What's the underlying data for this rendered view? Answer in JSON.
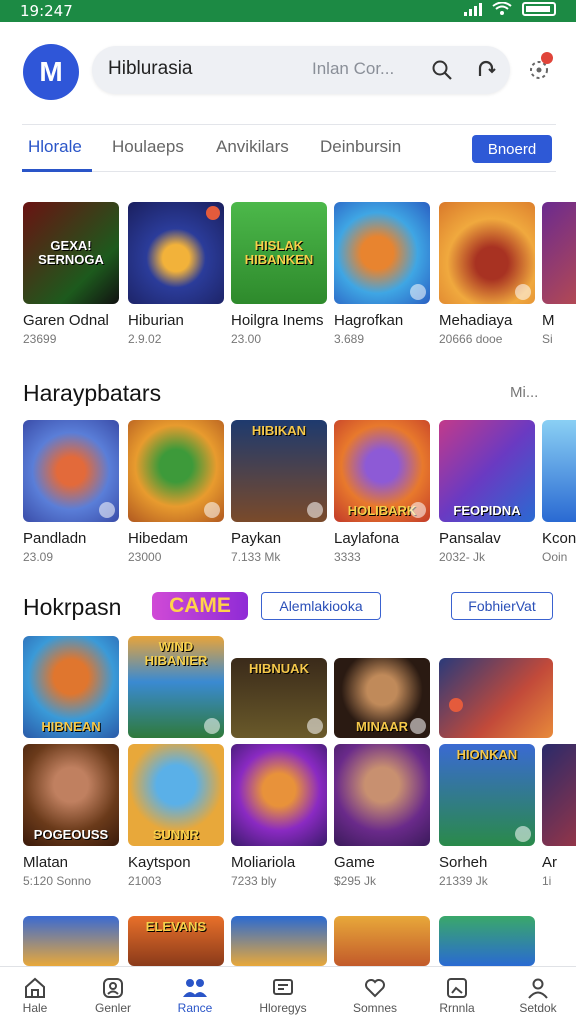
{
  "status": {
    "time": "19:247"
  },
  "colors": {
    "accent": "#2e59d6",
    "status_bar": "#1c8a44"
  },
  "header": {
    "logo_letter": "M",
    "search_title": "Hiblurasia",
    "search_placeholder": "Inlan Cor...",
    "icons": [
      "search-icon",
      "refresh-icon",
      "notification-icon"
    ]
  },
  "tabs": {
    "items": [
      "Hlorale",
      "Houlaeps",
      "Anvikilars",
      "Deinbursin"
    ],
    "active": 0,
    "button_label": "Bnoerd"
  },
  "row1": [
    {
      "thumb_text": "GEXA! SERNOGA",
      "name": "Garen Odnal",
      "meta": "23699"
    },
    {
      "thumb_text": "",
      "name": "Hiburian",
      "meta": "2.9.02"
    },
    {
      "thumb_text": "HISLAK HIBANKEN",
      "name": "Hoilgra Inems",
      "meta": "23.00"
    },
    {
      "thumb_text": "",
      "name": "Hagrofkan",
      "meta": "3.689"
    },
    {
      "thumb_text": "",
      "name": "Mehadiaya",
      "meta": "20666 dooe"
    },
    {
      "thumb_text": "",
      "name": "M",
      "meta": "Si"
    }
  ],
  "section2": {
    "title": "Haraypbatars",
    "more": "Mi...",
    "items": [
      {
        "thumb_text": "",
        "name": "Pandladn",
        "meta": "23.09"
      },
      {
        "thumb_text": "",
        "name": "Hibedam",
        "meta": "23000"
      },
      {
        "thumb_text": "HIBIKAN",
        "name": "Paykan",
        "meta": "7.133 Mk"
      },
      {
        "thumb_text": "HOLIBARK",
        "name": "Laylafona",
        "meta": "3333"
      },
      {
        "thumb_text": "FEOPIDNA",
        "name": "Pansalav",
        "meta": "2032- Jk"
      },
      {
        "thumb_text": "",
        "name": "Kcon",
        "meta": "Ooin"
      }
    ]
  },
  "section3": {
    "title": "Hokrpasn",
    "game_badge": "CAME",
    "pill1": "Alemlakiooka",
    "pill2": "FobhierVat",
    "grid_top": [
      {
        "thumb_text": "HIBNEAN"
      },
      {
        "thumb_text": "WIND HIBANIER"
      },
      {
        "thumb_text": "HIBNUAK"
      },
      {
        "thumb_text": "MINAAR"
      },
      {
        "thumb_text": ""
      }
    ],
    "grid_bottom": [
      {
        "thumb_text": "POGEOUSS",
        "name": "Mlatan",
        "meta": "5:120 Sonno"
      },
      {
        "thumb_text": "SUNNR",
        "name": "Kaytspon",
        "meta": "21003"
      },
      {
        "thumb_text": "",
        "name": "Moliariola",
        "meta": "7233 bly"
      },
      {
        "thumb_text": "",
        "name": "Game",
        "meta": "$295 Jk"
      },
      {
        "thumb_text": "HIONKAN",
        "name": "Sorheh",
        "meta": "21339 Jk"
      },
      {
        "thumb_text": "",
        "name": "Ar",
        "meta": "1i"
      }
    ],
    "row_peek": [
      {
        "thumb_text": ""
      },
      {
        "thumb_text": "ELEVANS"
      },
      {
        "thumb_text": ""
      },
      {
        "thumb_text": ""
      },
      {
        "thumb_text": ""
      }
    ]
  },
  "bottom_nav": [
    {
      "label": "Hale",
      "icon": "home-icon"
    },
    {
      "label": "Genler",
      "icon": "gamepad-icon"
    },
    {
      "label": "Rance",
      "icon": "people-icon"
    },
    {
      "label": "Hloregys",
      "icon": "chat-icon"
    },
    {
      "label": "Somnes",
      "icon": "heart-icon"
    },
    {
      "label": "Rrnnla",
      "icon": "photo-icon"
    },
    {
      "label": "Setdok",
      "icon": "person-icon"
    }
  ],
  "bottom_nav_active": 2
}
